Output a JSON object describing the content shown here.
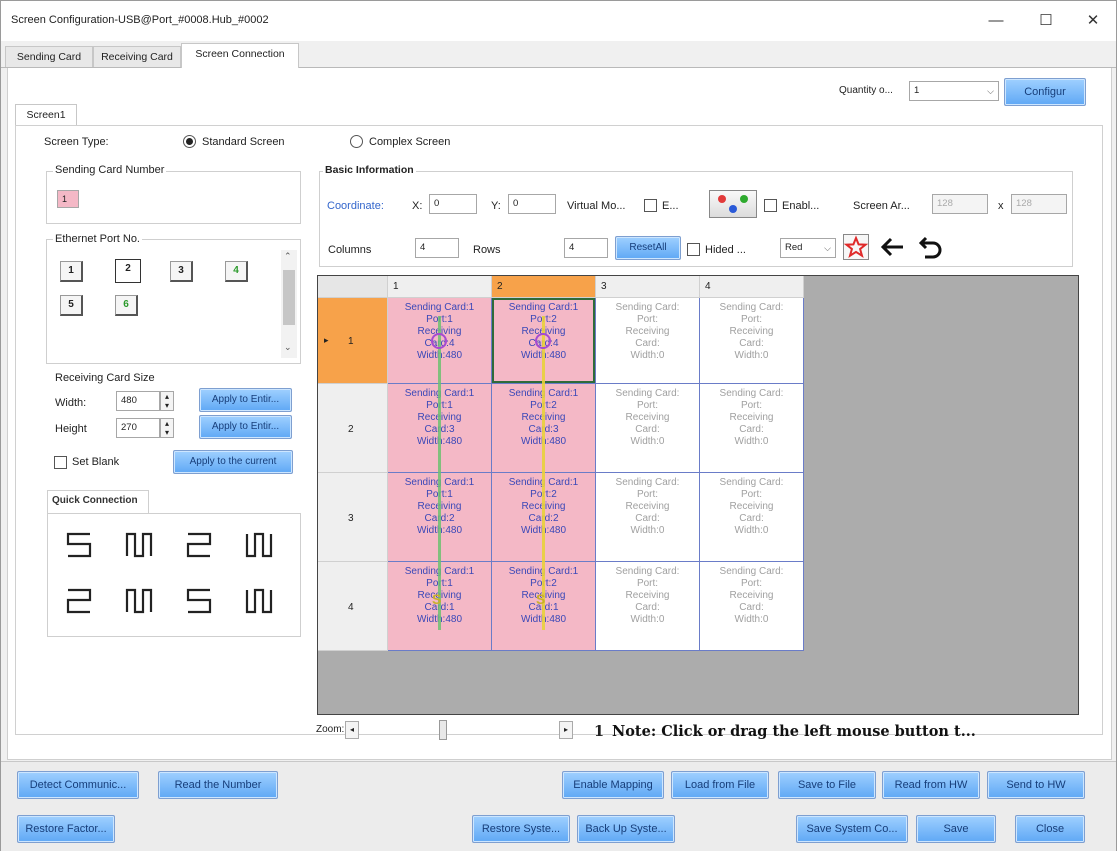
{
  "window": {
    "title": "Screen Configuration-USB@Port_#0008.Hub_#0002",
    "minimize": "—",
    "maximize": "☐",
    "close": "✕"
  },
  "tabs": [
    "Sending Card",
    "Receiving Card",
    "Screen Connection"
  ],
  "quantity": {
    "label": "Quantity o...",
    "value": "1",
    "configure": "Configur"
  },
  "screen_tab": "Screen1",
  "screen_type": {
    "label": "Screen Type:",
    "standard": "Standard Screen",
    "complex": "Complex Screen",
    "selected": "standard"
  },
  "sending_card_number": {
    "label": "Sending Card Number",
    "value": "1"
  },
  "ethernet_port": {
    "label": "Ethernet Port No.",
    "ports": [
      "1",
      "2",
      "3",
      "4",
      "5",
      "6"
    ]
  },
  "receiving_card_size": {
    "label": "Receiving Card Size",
    "width_label": "Width:",
    "width_value": "480",
    "height_label": "Height",
    "height_value": "270",
    "apply_width": "Apply to Entir...",
    "apply_height": "Apply to Entir...",
    "set_blank": "Set Blank",
    "apply_current": "Apply to the current"
  },
  "quick_connection": {
    "label": "Quick Connection"
  },
  "basic_info": {
    "label": "Basic Information",
    "coordinate": "Coordinate:",
    "x_label": "X:",
    "x_value": "0",
    "y_label": "Y:",
    "y_value": "0",
    "virtual_mode": "Virtual Mo...",
    "enable_e": "E...",
    "enable_b": "Enabl...",
    "screen_area": "Screen Ar...",
    "area_w": "128",
    "area_x": "x",
    "area_h": "128",
    "columns_label": "Columns",
    "columns_value": "4",
    "rows_label": "Rows",
    "rows_value": "4",
    "reset_all": "ResetAll",
    "hide": "Hided ...",
    "color": "Red"
  },
  "grid": {
    "col_headers": [
      "1",
      "2",
      "3",
      "4"
    ],
    "row_headers": [
      "1",
      "2",
      "3",
      "4"
    ],
    "selected_row_marker": "▸",
    "cells": [
      [
        {
          "lines": [
            "Sending Card:1",
            "Port:1",
            "Receiving",
            "Card:4",
            "Width:480"
          ],
          "state": "pink"
        },
        {
          "lines": [
            "Sending Card:1",
            "Port:2",
            "Receiving",
            "Card:4",
            "Width:480"
          ],
          "state": "pink"
        },
        {
          "lines": [
            "Sending Card:",
            "Port:",
            "Receiving",
            "Card:",
            "Width:0"
          ],
          "state": "white"
        },
        {
          "lines": [
            "Sending Card:",
            "Port:",
            "Receiving",
            "Card:",
            "Width:0"
          ],
          "state": "white"
        }
      ],
      [
        {
          "lines": [
            "Sending Card:1",
            "Port:1",
            "Receiving",
            "Card:3",
            "Width:480"
          ],
          "state": "pink"
        },
        {
          "lines": [
            "Sending Card:1",
            "Port:2",
            "Receiving",
            "Card:3",
            "Width:480"
          ],
          "state": "pink"
        },
        {
          "lines": [
            "Sending Card:",
            "Port:",
            "Receiving",
            "Card:",
            "Width:0"
          ],
          "state": "white"
        },
        {
          "lines": [
            "Sending Card:",
            "Port:",
            "Receiving",
            "Card:",
            "Width:0"
          ],
          "state": "white"
        }
      ],
      [
        {
          "lines": [
            "Sending Card:1",
            "Port:1",
            "Receiving",
            "Card:2",
            "Width:480"
          ],
          "state": "pink"
        },
        {
          "lines": [
            "Sending Card:1",
            "Port:2",
            "Receiving",
            "Card:2",
            "Width:480"
          ],
          "state": "pink"
        },
        {
          "lines": [
            "Sending Card:",
            "Port:",
            "Receiving",
            "Card:",
            "Width:0"
          ],
          "state": "white"
        },
        {
          "lines": [
            "Sending Card:",
            "Port:",
            "Receiving",
            "Card:",
            "Width:0"
          ],
          "state": "white"
        }
      ],
      [
        {
          "lines": [
            "Sending Card:1",
            "Port:1",
            "Receiving",
            "Card:1",
            "Width:480"
          ],
          "state": "pink"
        },
        {
          "lines": [
            "Sending Card:1",
            "Port:2",
            "Receiving",
            "Card:1",
            "Width:480"
          ],
          "state": "pink"
        },
        {
          "lines": [
            "Sending Card:",
            "Port:",
            "Receiving",
            "Card:",
            "Width:0"
          ],
          "state": "white"
        },
        {
          "lines": [
            "Sending Card:",
            "Port:",
            "Receiving",
            "Card:",
            "Width:0"
          ],
          "state": "white"
        }
      ]
    ]
  },
  "zoom": {
    "label": "Zoom:",
    "value": "1"
  },
  "note": "Note: Click or drag the left mouse button t...",
  "bottom_row1": [
    "Detect Communic...",
    "Read the Number",
    "Enable Mapping",
    "Load from File",
    "Save to File",
    "Read from HW",
    "Send to HW"
  ],
  "bottom_row2": [
    "Restore Factor...",
    "Restore Syste...",
    "Back Up Syste...",
    "Save System Co...",
    "Save",
    "Close"
  ],
  "colors": {
    "accent": "#5fa8f5",
    "pink_cell": "#f4b8c6",
    "selected_header": "#f7a24a",
    "wire_green": "#6cc070",
    "wire_yellow": "#e8d23a"
  }
}
